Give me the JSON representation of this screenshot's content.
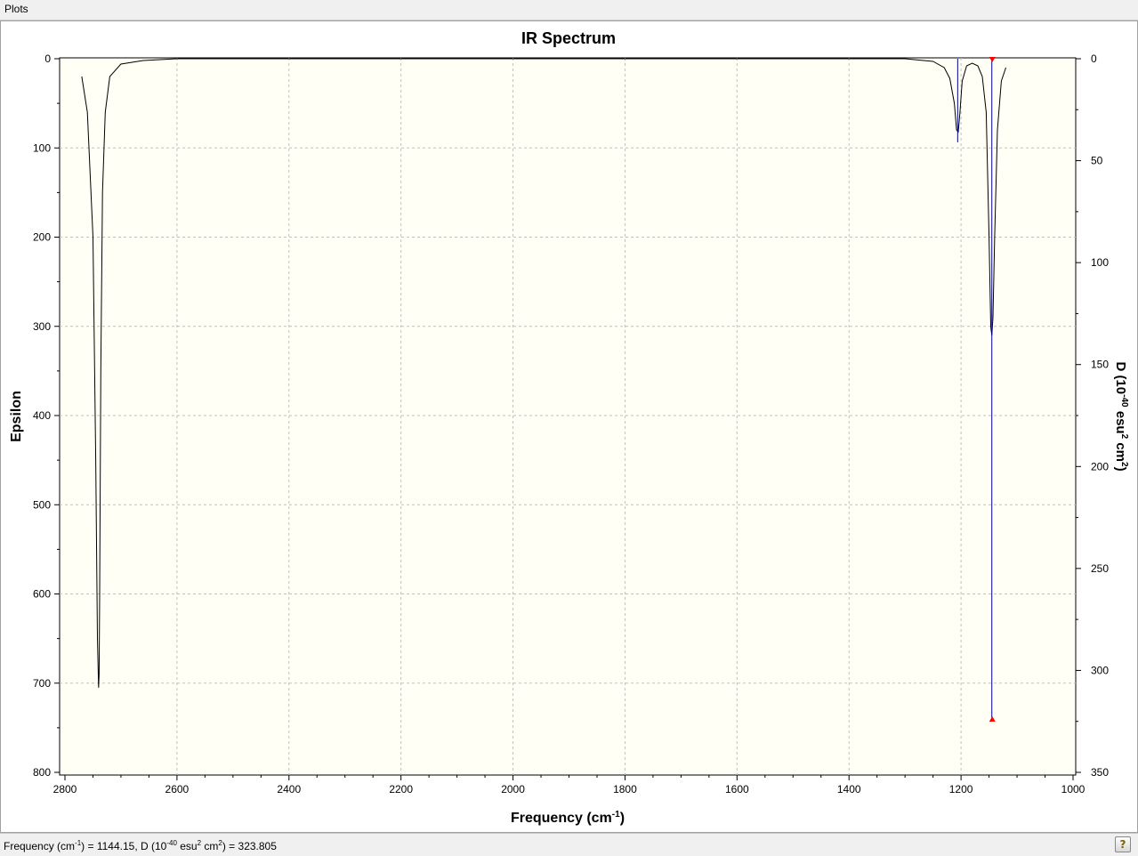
{
  "menu": {
    "plots_label": "Plots"
  },
  "status": {
    "prefix_a": "Frequency (cm",
    "sup_a": "-1",
    "prefix_b": ") = ",
    "freq_value": "1144.15",
    "prefix_c": ", D (10",
    "sup_b": "-40",
    "prefix_d": " esu",
    "sup_c": "2",
    "prefix_e": " cm",
    "sup_d": "2",
    "prefix_f": ") = ",
    "d_value": "323.805"
  },
  "help_button": {
    "glyph": "?",
    "icon": "help-icon"
  },
  "colors": {
    "plot_background": "#fffff5",
    "curve": "#000000",
    "stick": "#00008b",
    "marker": "#ff0000",
    "grid": "#c0c0c0"
  },
  "chart_data": {
    "type": "line",
    "title": "IR Spectrum",
    "xlabel": {
      "main": "Frequency (cm",
      "sup": "-1",
      "tail": ")"
    },
    "ylabel": "Epsilon",
    "y2label": {
      "p1": "D (10",
      "s1": "-40",
      "p2": " esu",
      "s2": "2",
      "p3": " cm",
      "s3": "2",
      "p4": ")"
    },
    "xlim": [
      2800,
      1000
    ],
    "ylim": [
      0,
      800
    ],
    "y2lim": [
      0,
      350
    ],
    "y_inverted": true,
    "grid": true,
    "x_ticks": [
      "2800",
      "2600",
      "2400",
      "2200",
      "2000",
      "1800",
      "1600",
      "1400",
      "1200",
      "1000"
    ],
    "x_tick_values": [
      2800,
      2600,
      2400,
      2200,
      2000,
      1800,
      1600,
      1400,
      1200,
      1000
    ],
    "y_ticks": [
      "0",
      "100",
      "200",
      "300",
      "400",
      "500",
      "600",
      "700",
      "800"
    ],
    "y_tick_values": [
      0,
      100,
      200,
      300,
      400,
      500,
      600,
      700,
      800
    ],
    "y2_ticks": [
      "0",
      "50",
      "100",
      "150",
      "200",
      "250",
      "300",
      "350"
    ],
    "y2_tick_values": [
      0,
      50,
      100,
      150,
      200,
      250,
      300,
      350
    ],
    "spectrum": {
      "name": "Epsilon",
      "x": [
        2770,
        2760,
        2750,
        2745,
        2742,
        2740,
        2739,
        2738,
        2736,
        2733,
        2728,
        2720,
        2700,
        2660,
        2600,
        2400,
        2000,
        1600,
        1300,
        1250,
        1230,
        1220,
        1212,
        1208,
        1205,
        1202,
        1198,
        1190,
        1180,
        1170,
        1162,
        1155,
        1150,
        1147,
        1145,
        1143,
        1140,
        1135,
        1128,
        1120
      ],
      "y": [
        20,
        60,
        200,
        450,
        650,
        705,
        690,
        600,
        350,
        150,
        60,
        20,
        6,
        2,
        0,
        0,
        0,
        0,
        0,
        3,
        10,
        22,
        50,
        80,
        82,
        60,
        25,
        8,
        5,
        8,
        20,
        60,
        200,
        300,
        310,
        290,
        200,
        80,
        25,
        10
      ]
    },
    "sticks": [
      {
        "x": 2740,
        "d": 0
      },
      {
        "x": 1206,
        "d": 41
      },
      {
        "x": 1145,
        "d": 323.805
      }
    ],
    "selected": {
      "x": 1144.15,
      "d": 323.805
    }
  }
}
